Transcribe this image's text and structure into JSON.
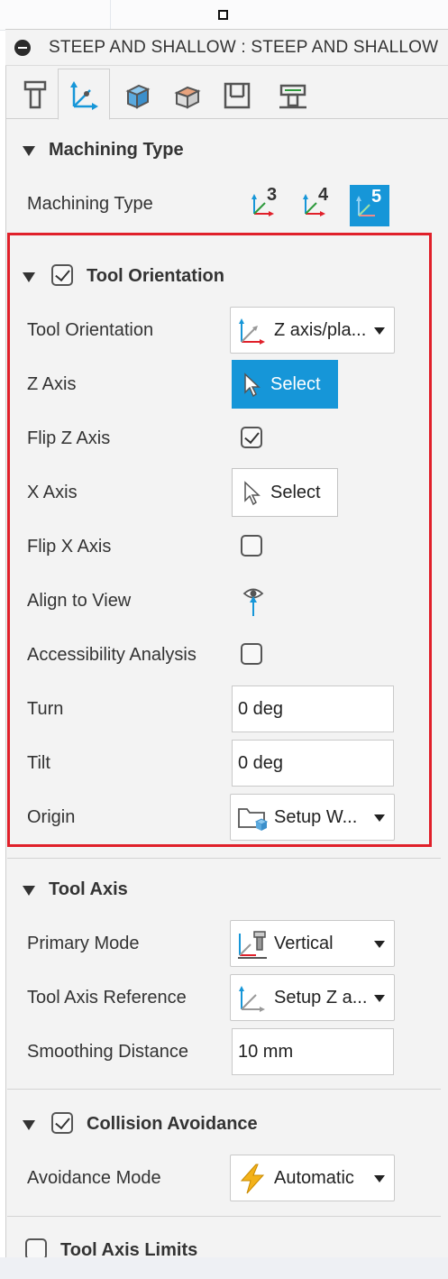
{
  "header": {
    "title": "STEEP AND SHALLOW : STEEP AND SHALLOW"
  },
  "tabs": [
    {
      "name": "tool",
      "icon": "tool-tab-icon"
    },
    {
      "name": "geometry",
      "icon": "axis-tab-icon",
      "active": true
    },
    {
      "name": "heights",
      "icon": "heights-tab-icon"
    },
    {
      "name": "passes",
      "icon": "passes-tab-icon"
    },
    {
      "name": "linking",
      "icon": "linking-tab-icon"
    },
    {
      "name": "shaft",
      "icon": "shaft-tab-icon"
    }
  ],
  "machining": {
    "section_title": "Machining Type",
    "label": "Machining Type",
    "options": [
      "3",
      "4",
      "5"
    ],
    "selected": "5"
  },
  "tool_orientation": {
    "section_title": "Tool Orientation",
    "enabled": true,
    "orientation_label": "Tool Orientation",
    "orientation_value": "Z axis/pla...",
    "z_axis_label": "Z Axis",
    "z_axis_button": "Select",
    "flip_z_label": "Flip Z Axis",
    "flip_z_checked": true,
    "x_axis_label": "X Axis",
    "x_axis_button": "Select",
    "flip_x_label": "Flip X Axis",
    "flip_x_checked": false,
    "align_label": "Align to View",
    "access_label": "Accessibility Analysis",
    "access_checked": false,
    "turn_label": "Turn",
    "turn_value": "0 deg",
    "tilt_label": "Tilt",
    "tilt_value": "0 deg",
    "origin_label": "Origin",
    "origin_value": "Setup W..."
  },
  "tool_axis": {
    "section_title": "Tool Axis",
    "primary_label": "Primary Mode",
    "primary_value": "Vertical",
    "reference_label": "Tool Axis Reference",
    "reference_value": "Setup Z a...",
    "smoothing_label": "Smoothing Distance",
    "smoothing_value": "10 mm"
  },
  "collision": {
    "section_title": "Collision Avoidance",
    "enabled": true,
    "mode_label": "Avoidance Mode",
    "mode_value": "Automatic"
  },
  "limits": {
    "section_title": "Tool Axis Limits",
    "enabled": false
  },
  "colors": {
    "accent": "#1696d8",
    "highlight_border": "#e0202a",
    "panel_bg": "#f3f3f3"
  }
}
